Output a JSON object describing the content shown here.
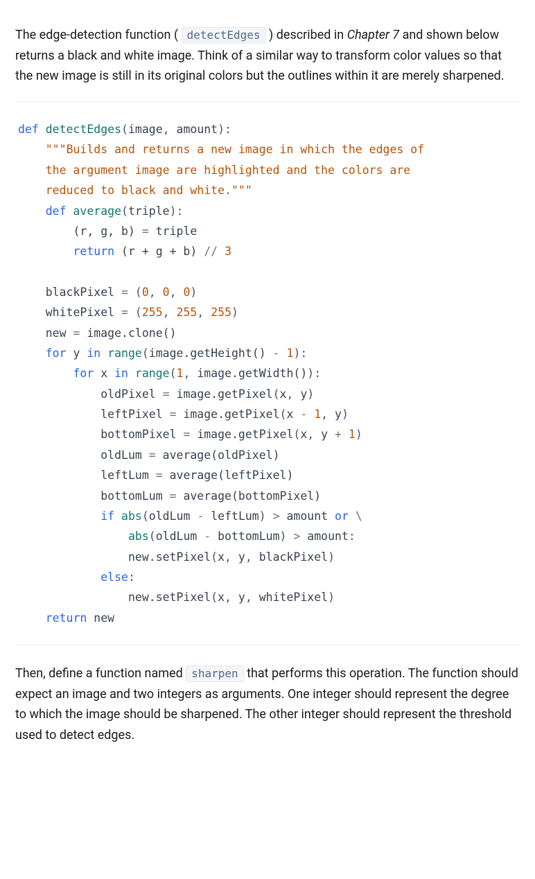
{
  "intro": {
    "t1": "The edge-detection function ( ",
    "code1": "detectEdges",
    "t2": " ) described in ",
    "ital": "Chapter 7",
    "t3": " and shown below returns a black and white image. Think of a similar way to transform color values so that the new image is still in its original colors but the outlines within it are merely sharpened."
  },
  "code": {
    "kw_def": "def",
    "fn_detectEdges": "detectEdges",
    "lp": "(",
    "rp": ")",
    "colon": ":",
    "comma": ",",
    "arg_image": "image",
    "arg_amount": "amount",
    "docstring_open": "\"\"\"",
    "doc_l1": "Builds and returns a new image in which the edges of",
    "doc_l2": "the argument image are highlighted and the colors are",
    "doc_l3": "reduced to black and white.",
    "docstring_close": "\"\"\"",
    "fn_average": "average",
    "arg_triple": "triple",
    "tuple_rgb": "(r, g, b)",
    "eq": "=",
    "id_triple": "triple",
    "kw_return": "return",
    "expr_avg": "(r + g + b)",
    "floordiv": "//",
    "num_3": "3",
    "id_blackPixel": "blackPixel",
    "tuple_000_a": "(",
    "num_0a": "0",
    "num_0b": "0",
    "num_0c": "0",
    "tuple_000_b": ")",
    "id_whitePixel": "whitePixel",
    "num_255a": "255",
    "num_255b": "255",
    "num_255c": "255",
    "id_new": "new",
    "call_clone": "image.clone()",
    "kw_for": "for",
    "id_y": "y",
    "kw_in": "in",
    "fn_range": "range",
    "call_getHeight": "image.getHeight()",
    "minus": "-",
    "num_1": "1",
    "id_x": "x",
    "call_getWidth": "image.getWidth()",
    "id_oldPixel": "oldPixel",
    "call_getPixel": "image.getPixel",
    "id_leftPixel": "leftPixel",
    "id_bottomPixel": "bottomPixel",
    "plus": "+",
    "id_oldLum": "oldLum",
    "call_avg_old": "average(oldPixel)",
    "id_leftLum": "leftLum",
    "call_avg_left": "average(leftPixel)",
    "id_bottomLum": "bottomLum",
    "call_avg_bottom": "average(bottomPixel)",
    "kw_if": "if",
    "fn_abs": "abs",
    "gt": ">",
    "id_amount": "amount",
    "kw_or": "or",
    "bslash": "\\",
    "call_setPixel": "new.setPixel",
    "kw_else": "else",
    "id_black": "blackPixel",
    "id_white": "whitePixel"
  },
  "outro": {
    "t1": "Then, define a function named ",
    "code1": "sharpen",
    "t2": " that performs this operation. The function should expect an image and two integers as arguments. One integer should represent the degree to which the image should be sharpened. The other integer should represent the threshold used to detect edges."
  }
}
